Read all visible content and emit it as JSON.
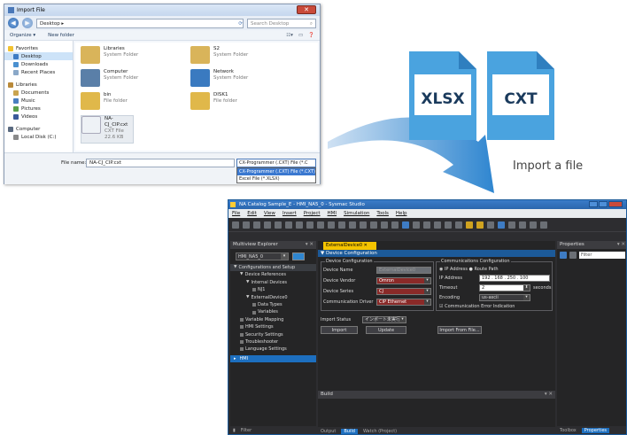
{
  "dialog": {
    "title": "Import File",
    "address": "Desktop ▸",
    "search_placeholder": "Search Desktop",
    "toolbar": {
      "organize": "Organize ▾",
      "new_folder": "New folder"
    },
    "nav": [
      {
        "label": "Favorites",
        "sub": false
      },
      {
        "label": "Desktop",
        "sub": true,
        "selected": true
      },
      {
        "label": "Downloads",
        "sub": true
      },
      {
        "label": "Recent Places",
        "sub": true
      },
      {
        "label": "Libraries",
        "sub": false
      },
      {
        "label": "Documents",
        "sub": true
      },
      {
        "label": "Music",
        "sub": true
      },
      {
        "label": "Pictures",
        "sub": true
      },
      {
        "label": "Videos",
        "sub": true
      },
      {
        "label": "Computer",
        "sub": false
      },
      {
        "label": "Local Disk (C:)",
        "sub": true
      }
    ],
    "files": [
      {
        "name": "Libraries",
        "type": "System Folder"
      },
      {
        "name": "S2",
        "type": "System Folder"
      },
      {
        "name": "Computer",
        "type": "System Folder"
      },
      {
        "name": "Network",
        "type": "System Folder"
      },
      {
        "name": "bin",
        "type": "File folder"
      },
      {
        "name": "DISK1",
        "type": "File folder"
      },
      {
        "name": "NA-CJ_CIP.cxt",
        "type": "CXT File",
        "size": "22.6 KB"
      }
    ],
    "file_name_label": "File name:",
    "file_name_value": "NA-CJ_CIP.cxt",
    "file_type_value": "CX-Programmer (.CXT) File (*.C",
    "file_type_options": [
      "CX-Programmer (.CXT) File (*.CXT)",
      "Excel File (*.XLSX)"
    ]
  },
  "badges": {
    "xlsx": "XLSX",
    "cxt": "CXT",
    "caption": "Import a file"
  },
  "ide": {
    "title": "NA Catalog Sample_E - HMI_NA5_0 - Sysmac Studio",
    "menu": [
      "File",
      "Edit",
      "View",
      "Insert",
      "Project",
      "HMI",
      "Simulation",
      "Tools",
      "Help"
    ],
    "explorer": {
      "header": "Multiview Explorer",
      "combo": "HMI_NA5_0",
      "tree": [
        {
          "label": "Configurations and Setup",
          "level": 0
        },
        {
          "label": "Device References",
          "level": 1
        },
        {
          "label": "Internal Devices",
          "level": 2
        },
        {
          "label": "NJ1",
          "level": 3
        },
        {
          "label": "ExternalDevice0",
          "level": 2
        },
        {
          "label": "Data Types",
          "level": 3
        },
        {
          "label": "Variables",
          "level": 3
        },
        {
          "label": "Variable Mapping",
          "level": 1
        },
        {
          "label": "HMI Settings",
          "level": 1
        },
        {
          "label": "Security Settings",
          "level": 1
        },
        {
          "label": "Troubleshooter",
          "level": 1
        },
        {
          "label": "Language Settings",
          "level": 1
        }
      ],
      "hmi": "HMI",
      "filter": "Filter"
    },
    "editor": {
      "tab": "ExternalDevice0",
      "header": "Device Configuration",
      "device_group": "Device Configuration",
      "fields": [
        {
          "label": "Device Name",
          "value": "ExternalDevice0"
        },
        {
          "label": "Device Vendor",
          "value": "Omron"
        },
        {
          "label": "Device Series",
          "value": "CJ"
        },
        {
          "label": "Communication Driver",
          "value": "CIP Ethernet"
        }
      ],
      "comm_group": "Communications Configuration",
      "ip_radio": "IP Address",
      "route_radio": "Route Path",
      "ip_label": "IP Address",
      "ip_value": "192 . 168 . 250 . 100",
      "timeout_label": "Timeout",
      "timeout_value": "2",
      "timeout_unit": "seconds",
      "encoding_label": "Encoding",
      "encoding_value": "us-ascii",
      "comm_error": "Communication Error Indication",
      "import_status_label": "Import Status",
      "import_status_value": "インポート未実行",
      "buttons": [
        "Import",
        "Update",
        "Import From File..."
      ]
    },
    "build": {
      "header": "Build",
      "tabs": [
        "Output",
        "Build",
        "Watch (Project)"
      ]
    },
    "properties": {
      "header": "Properties",
      "filter": "Filter",
      "tabs": [
        "Toolbox",
        "Properties"
      ]
    }
  }
}
